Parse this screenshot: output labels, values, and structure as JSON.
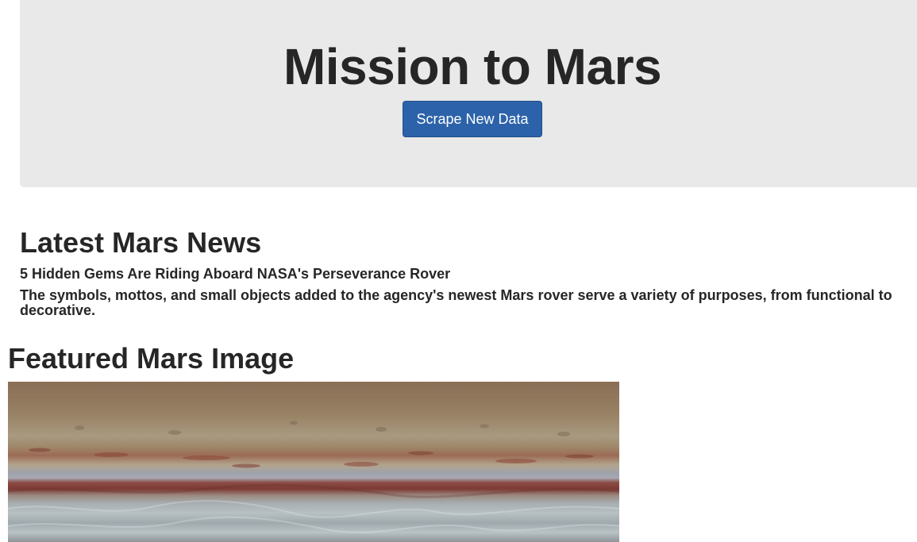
{
  "header": {
    "title": "Mission to Mars",
    "scrape_button_label": "Scrape New Data"
  },
  "news": {
    "heading": "Latest Mars News",
    "title": "5 Hidden Gems Are Riding Aboard NASA's Perseverance Rover",
    "paragraph": "The symbols, mottos, and small objects added to the agency's newest Mars rover serve a variety of purposes, from functional to decorative."
  },
  "featured_image": {
    "heading": "Featured Mars Image"
  },
  "colors": {
    "jumbotron_bg": "#e9e9e9",
    "button_bg": "#2c62a9",
    "text": "#262626"
  }
}
